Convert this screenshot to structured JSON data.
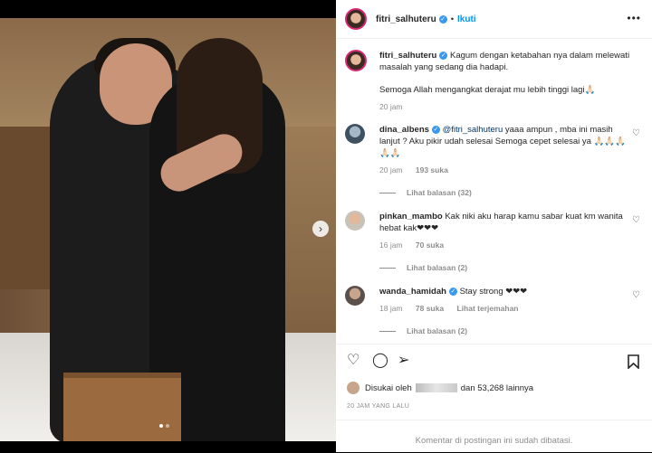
{
  "post": {
    "username": "fitri_salhuteru",
    "separator": "•",
    "follow_label": "Ikuti",
    "more_label": "•••",
    "caption_user": "fitri_salhuteru",
    "caption_line1": "Kagum dengan ketabahan nya dalam melewati masalah yang sedang dia hadapi.",
    "caption_line2": "Semoga Allah mengangkat derajat mu lebih tinggi lagi🙏🏻",
    "caption_time": "20 jam"
  },
  "comments": [
    {
      "user": "dina_albens",
      "mention": "@fitri_salhuteru",
      "text": " yaaa ampun , mba ini masih lanjut ? Aku pikir udah selesai Semoga cepet selesai ya 🙏🏻🙏🏻🙏🏻🙏🏻🙏🏻",
      "time": "20 jam",
      "likes": "193 suka",
      "replies": "Lihat balasan (32)"
    },
    {
      "user": "pinkan_mambo",
      "text": "Kak niki aku harap kamu sabar kuat km wanita hebat kak❤❤❤",
      "time": "16 jam",
      "likes": "70 suka",
      "replies": "Lihat balasan (2)"
    },
    {
      "user": "wanda_hamidah",
      "text": "Stay strong ❤❤❤",
      "time": "18 jam",
      "likes": "78 suka",
      "translate": "Lihat terjemahan",
      "replies": "Lihat balasan (2)"
    }
  ],
  "likes": {
    "prefix": "Disukai oleh",
    "suffix": "dan 53,268 lainnya"
  },
  "post_time": "20 JAM YANG LALU",
  "comments_closed": "Komentar di postingan ini sudah dibatasi.",
  "icons": {
    "like": "heart-icon",
    "comment": "comment-icon",
    "share": "paper-plane-icon",
    "save": "bookmark-icon",
    "next": "chevron-right-icon"
  },
  "colors": {
    "link": "#0095f6",
    "verified": "#3897f0",
    "muted": "#8e8e8e"
  }
}
